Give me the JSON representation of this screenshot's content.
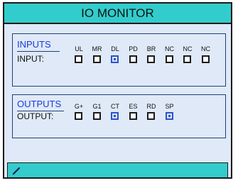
{
  "title": "IO MONITOR",
  "inputs": {
    "heading": "INPUTS",
    "row_label": "INPUT:",
    "channels": [
      {
        "label": "UL",
        "checked": false
      },
      {
        "label": "MR",
        "checked": false
      },
      {
        "label": "DL",
        "checked": true
      },
      {
        "label": "PD",
        "checked": false
      },
      {
        "label": "BR",
        "checked": false
      },
      {
        "label": "NC",
        "checked": false
      },
      {
        "label": "NC",
        "checked": false
      },
      {
        "label": "NC",
        "checked": false
      }
    ]
  },
  "outputs": {
    "heading": "OUTPUTS",
    "row_label": "OUTPUT:",
    "channels": [
      {
        "label": "G+",
        "checked": false
      },
      {
        "label": "G1",
        "checked": false
      },
      {
        "label": "CT",
        "checked": true
      },
      {
        "label": "ES",
        "checked": false
      },
      {
        "label": "RD",
        "checked": false
      },
      {
        "label": "SP",
        "checked": true
      }
    ]
  },
  "colors": {
    "accent": "#33cccc",
    "panel": "#dfe9f7",
    "heading": "#1a3ad9",
    "checked": "#2a55c8"
  },
  "statusbar": {
    "icon": "pencil-icon"
  }
}
